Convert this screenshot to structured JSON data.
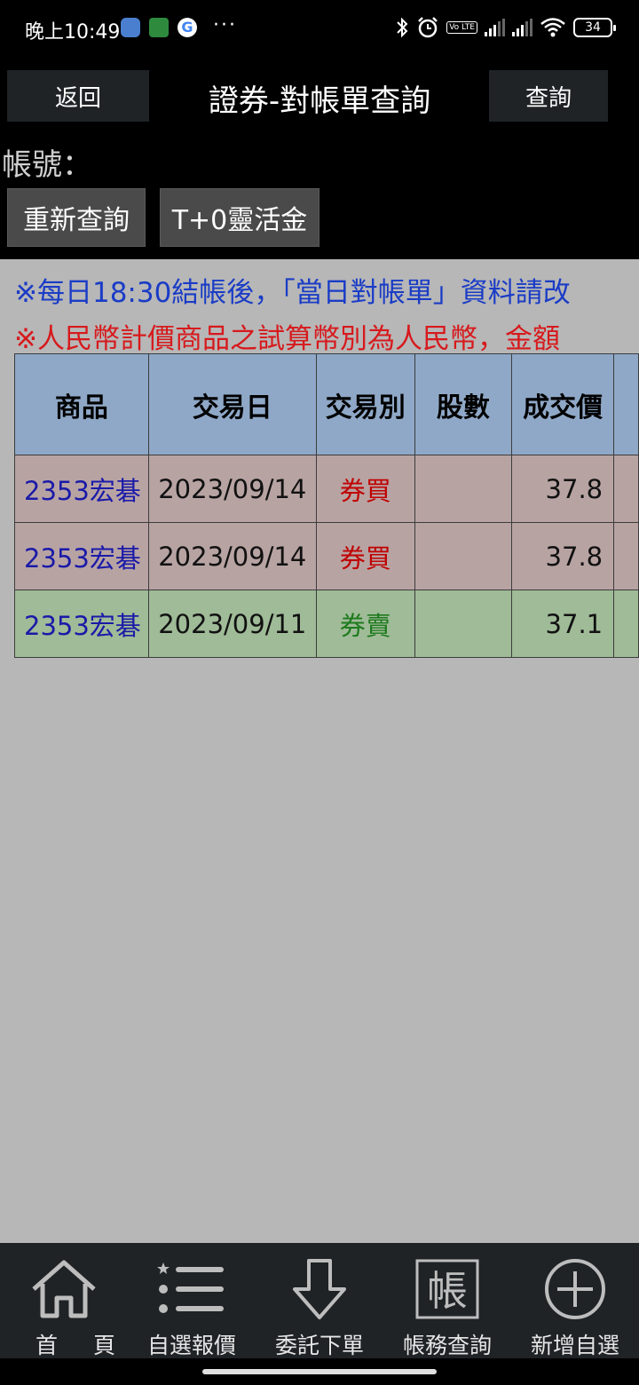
{
  "status_bar": {
    "time": "晚上10:49",
    "dots": "···",
    "volte": "Vo LTE",
    "battery": "34"
  },
  "header": {
    "back_label": "返回",
    "title": "證券-對帳單查詢",
    "query_label": "查詢",
    "account_label": "帳號：",
    "requery_label": "重新查詢",
    "t0_label": "T+0靈活金"
  },
  "notices": {
    "blue": "※每日18:30結帳後，「當日對帳單」資料請改",
    "red": "※人民幣計價商品之試算幣別為人民幣，金額"
  },
  "table": {
    "columns": [
      "商品",
      "交易日",
      "交易別",
      "股數",
      "成交價"
    ],
    "rows": [
      {
        "product": "2353宏碁",
        "date": "2023/09/14",
        "type": "券買",
        "shares": "",
        "price": "37.8",
        "kind": "buy"
      },
      {
        "product": "2353宏碁",
        "date": "2023/09/14",
        "type": "券買",
        "shares": "",
        "price": "37.8",
        "kind": "buy"
      },
      {
        "product": "2353宏碁",
        "date": "2023/09/11",
        "type": "券賣",
        "shares": "",
        "price": "37.1",
        "kind": "sell"
      }
    ]
  },
  "bottom_nav": [
    {
      "label": "首頁",
      "icon": "home-icon"
    },
    {
      "label": "自選報價",
      "icon": "watchlist-icon"
    },
    {
      "label": "委託下單",
      "icon": "order-arrow-icon"
    },
    {
      "label": "帳務查詢",
      "icon": "account-query-icon",
      "icon_char": "帳"
    },
    {
      "label": "新增自選",
      "icon": "add-circle-icon"
    }
  ],
  "colors": {
    "header_bg": "#8fa8c7",
    "buy_row": "#b8a3a3",
    "sell_row": "#9fbb97",
    "buy_text": "#c00000",
    "sell_text": "#1e7a1e",
    "product_text": "#1a1aa8"
  }
}
